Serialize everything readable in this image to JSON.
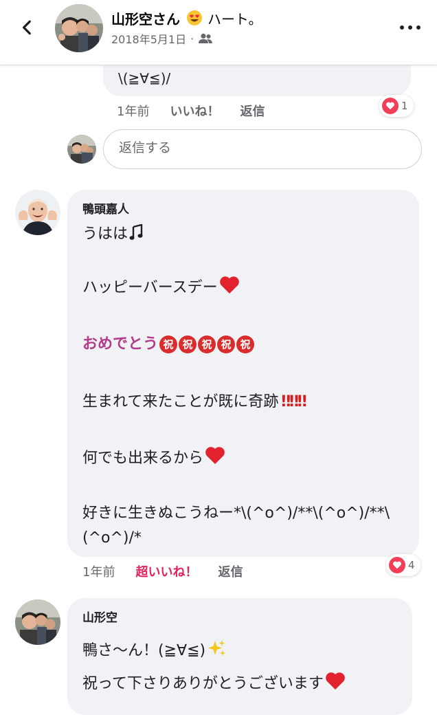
{
  "header": {
    "name": "山形空さん",
    "feeling": "ハート。",
    "date": "2018年5月1日",
    "separator": "·",
    "back_icon": "chevron-left-icon",
    "audience_icon": "friends-icon",
    "more_icon": "more-horizontal-icon"
  },
  "comments": [
    {
      "text": "\\(≧∀≦)/",
      "time": "1年前",
      "like_label": "いいね！",
      "reply_label": "返信",
      "reaction_count": "1"
    },
    {
      "author": "鴨頭嘉人",
      "lines": [
        "うはは",
        "ハッピーバースデー",
        "おめでとう",
        "生まれて来たことが既に奇跡",
        "何でも出来るから",
        "好きに生きぬこうねー*\\(^o^)/**\\(^o^)/**\\",
        "(^o^)/*"
      ],
      "badge_char": "祝",
      "time": "1年前",
      "like_label": "超いいね！",
      "reply_label": "返信",
      "reaction_count": "4"
    },
    {
      "author": "山形空",
      "lines": [
        "鴨さ〜ん！(≧∀≦)",
        "祝って下さりありがとうございます"
      ]
    }
  ],
  "reply_box": {
    "placeholder": "返信する"
  },
  "colors": {
    "like_super": "#e0245e",
    "pink_text": "#b23b8a",
    "reaction_heart": "#f33e58",
    "bubble": "#f0f2f5"
  }
}
